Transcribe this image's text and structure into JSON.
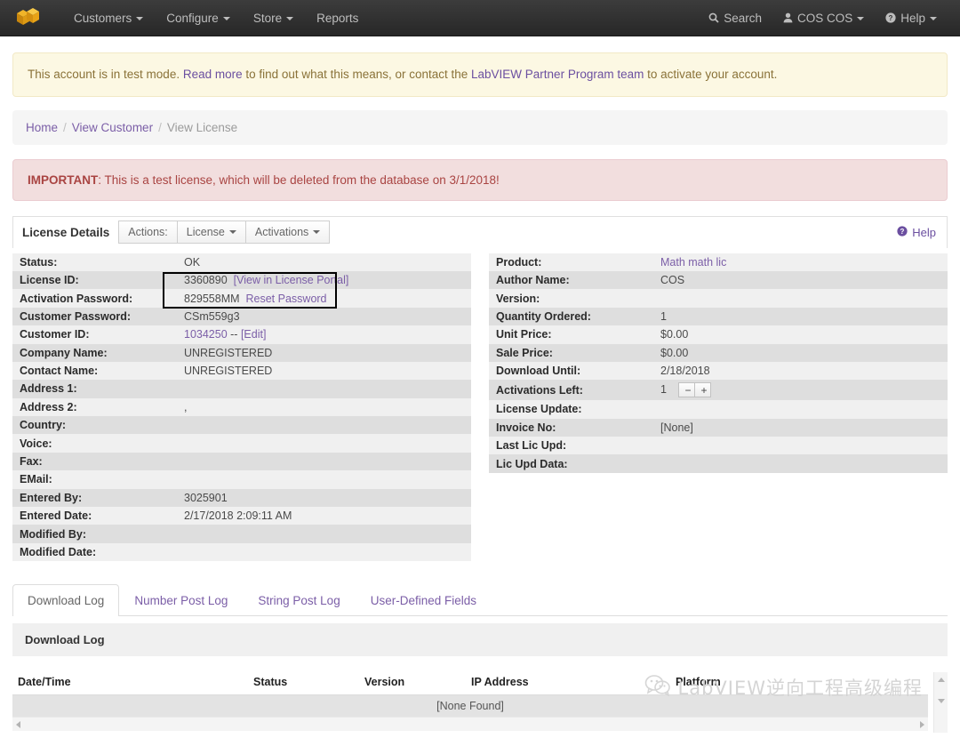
{
  "navbar": {
    "brand_icon": "cubes-logo-icon",
    "items": [
      {
        "label": "Customers",
        "caret": true
      },
      {
        "label": "Configure",
        "caret": true
      },
      {
        "label": "Store",
        "caret": true
      },
      {
        "label": "Reports",
        "caret": false
      }
    ],
    "right_items": [
      {
        "label": "Search",
        "icon": "search-icon",
        "caret": false
      },
      {
        "label": "COS COS",
        "icon": "user-icon",
        "caret": true
      },
      {
        "label": "Help",
        "icon": "question-circle-icon",
        "caret": true
      }
    ]
  },
  "test_mode_alert": {
    "text_1": "This account is in test mode. ",
    "link_1": "Read more",
    "text_2": " to find out what this means, or contact the ",
    "link_2": "LabVIEW Partner Program team",
    "text_3": " to activate your account."
  },
  "breadcrumb": {
    "items": [
      {
        "label": "Home",
        "link": true
      },
      {
        "label": "View Customer",
        "link": true
      },
      {
        "label": "View License",
        "link": false
      }
    ],
    "separator": "/"
  },
  "important_alert": {
    "prefix": "IMPORTANT",
    "text": ": This is a test license, which will be deleted from the database on 3/1/2018!"
  },
  "panel": {
    "title": "License Details",
    "actions_label": "Actions:",
    "buttons": [
      {
        "label": "License",
        "caret": true
      },
      {
        "label": "Activations",
        "caret": true
      }
    ],
    "help_label": "Help",
    "help_icon": "question-circle-icon"
  },
  "details_left": [
    {
      "label": "Status:",
      "value": "OK"
    },
    {
      "label": "License ID:",
      "value": "3360890",
      "link": "[View in License Portal]"
    },
    {
      "label": "Activation Password:",
      "value": "829558MM",
      "link": "Reset Password"
    },
    {
      "label": "Customer Password:",
      "value": "CSm559g3"
    },
    {
      "label": "Customer ID:",
      "value_link": "1034250",
      "value_mid": " -- ",
      "link": "[Edit]"
    },
    {
      "label": "Company Name:",
      "value": "UNREGISTERED"
    },
    {
      "label": "Contact Name:",
      "value": "UNREGISTERED"
    },
    {
      "label": "Address 1:",
      "value": ""
    },
    {
      "label": "Address 2:",
      "value": ","
    },
    {
      "label": "Country:",
      "value": ""
    },
    {
      "label": "Voice:",
      "value": ""
    },
    {
      "label": "Fax:",
      "value": ""
    },
    {
      "label": "EMail:",
      "value": ""
    },
    {
      "label": "Entered By:",
      "value": "3025901"
    },
    {
      "label": "Entered Date:",
      "value": "2/17/2018 2:09:11 AM"
    },
    {
      "label": "Modified By:",
      "value": ""
    },
    {
      "label": "Modified Date:",
      "value": ""
    }
  ],
  "details_right": [
    {
      "label": "Product:",
      "value_link": "Math math lic"
    },
    {
      "label": "Author Name:",
      "value": "COS"
    },
    {
      "label": "Version:",
      "value": ""
    },
    {
      "label": "Quantity Ordered:",
      "value": "1"
    },
    {
      "label": "Unit Price:",
      "value": "$0.00"
    },
    {
      "label": "Sale Price:",
      "value": "$0.00"
    },
    {
      "label": "Download Until:",
      "value": "2/18/2018"
    },
    {
      "label": "Activations Left:",
      "value": "1",
      "stepper": {
        "minus": "−",
        "plus": "+"
      }
    },
    {
      "label": "License Update:",
      "value": ""
    },
    {
      "label": "Invoice No:",
      "value": "[None]"
    },
    {
      "label": "Last Lic Upd:",
      "value": ""
    },
    {
      "label": "Lic Upd Data:",
      "value": ""
    }
  ],
  "tabs": [
    {
      "label": "Download Log",
      "active": true
    },
    {
      "label": "Number Post Log",
      "active": false
    },
    {
      "label": "String Post Log",
      "active": false
    },
    {
      "label": "User-Defined Fields",
      "active": false
    }
  ],
  "log_panel": {
    "heading": "Download Log",
    "columns": [
      "Date/Time",
      "Status",
      "Version",
      "IP Address",
      "Platform"
    ],
    "empty_message": "[None Found]"
  },
  "watermark": {
    "icon": "wechat-icon",
    "text": "LabVIEW逆向工程高级编程"
  },
  "colors": {
    "navbar_bg": "#333333",
    "link": "#7b5ea7",
    "warning_bg": "#fcf8e3",
    "danger_bg": "#f2dede",
    "danger_text": "#a94442",
    "brand_yellow": "#e8a317"
  }
}
